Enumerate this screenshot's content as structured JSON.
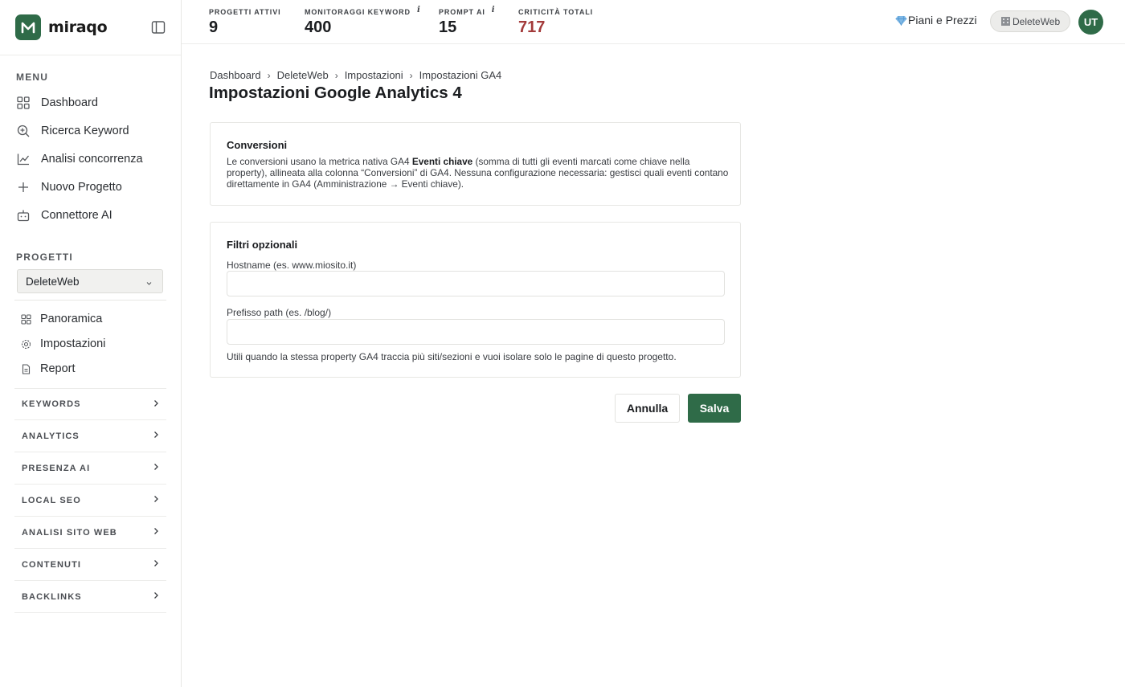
{
  "brand": {
    "name": "miraqo"
  },
  "sidebar": {
    "menu_label": "MENU",
    "menu_items": [
      {
        "label": "Dashboard",
        "icon": "grid-icon"
      },
      {
        "label": "Ricerca Keyword",
        "icon": "search-plus-icon"
      },
      {
        "label": "Analisi concorrenza",
        "icon": "line-chart-icon"
      },
      {
        "label": "Nuovo Progetto",
        "icon": "plus-icon"
      },
      {
        "label": "Connettore AI",
        "icon": "robot-icon"
      }
    ],
    "projects_label": "PROGETTI",
    "project_select": {
      "value": "DeleteWeb"
    },
    "project_items": [
      {
        "label": "Panoramica",
        "icon": "grid-icon"
      },
      {
        "label": "Impostazioni",
        "icon": "gear-icon"
      },
      {
        "label": "Report",
        "icon": "file-icon"
      }
    ],
    "groups": [
      "KEYWORDS",
      "ANALYTICS",
      "PRESENZA AI",
      "LOCAL SEO",
      "ANALISI SITO WEB",
      "CONTENUTI",
      "BACKLINKS"
    ]
  },
  "topbar": {
    "stats": [
      {
        "label": "PROGETTI ATTIVI",
        "value": "9",
        "info": ""
      },
      {
        "label": "MONITORAGGI KEYWORD",
        "value": "400",
        "info": "i"
      },
      {
        "label": "PROMPT AI",
        "value": "15",
        "info": "i"
      },
      {
        "label": "CRITICITÀ TOTALI",
        "value": "717",
        "info": ""
      }
    ],
    "plans_label": "Piani e Prezzi",
    "project_chip": "DeleteWeb",
    "avatar_initials": "UT"
  },
  "breadcrumb": [
    "Dashboard",
    "DeleteWeb",
    "Impostazioni",
    "Impostazioni GA4"
  ],
  "page_title": "Impostazioni Google Analytics 4",
  "conversions": {
    "title": "Conversioni",
    "text_before": "Le conversioni usano la metrica nativa GA4 ",
    "text_bold": "Eventi chiave",
    "text_after": " (somma di tutti gli eventi marcati come chiave nella property), allineata alla colonna “Conversioni” di GA4. Nessuna configurazione necessaria: gestisci quali eventi contano direttamente in GA4 (Amministrazione → Eventi chiave)."
  },
  "filters": {
    "title": "Filtri opzionali",
    "hostname_label": "Hostname (es. www.miosito.it)",
    "hostname_value": "",
    "path_label": "Prefisso path (es. /blog/)",
    "path_value": "",
    "hint": "Utili quando la stessa property GA4 traccia più siti/sezioni e vuoi isolare solo le pagine di questo progetto."
  },
  "actions": {
    "cancel": "Annulla",
    "save": "Salva"
  },
  "colors": {
    "brand": "#2f6b48",
    "critical": "#a33a3a"
  }
}
